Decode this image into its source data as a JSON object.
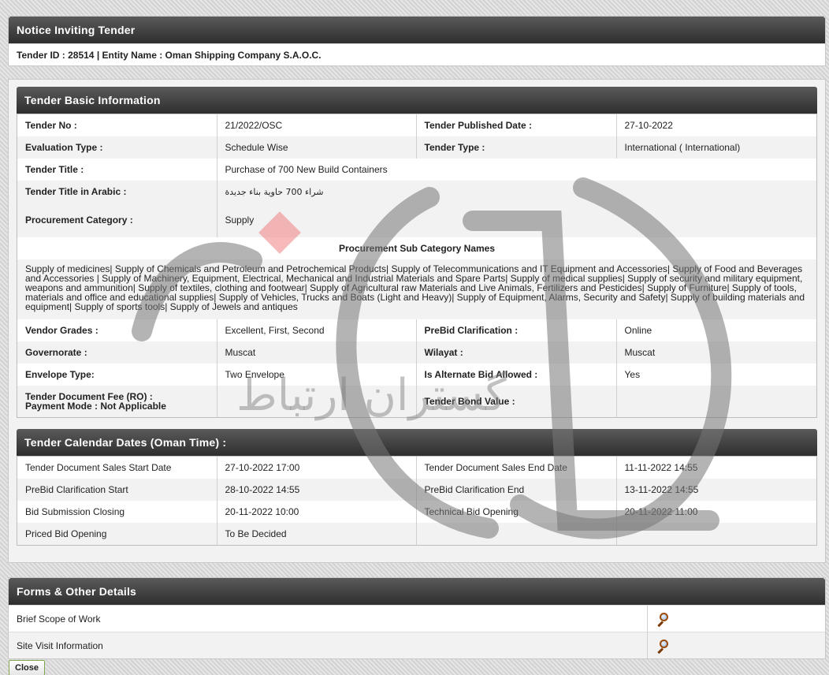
{
  "nit": {
    "title": "Notice Inviting Tender",
    "subline": "Tender ID : 28514 | Entity Name : Oman Shipping Company S.A.O.C."
  },
  "basic": {
    "title": "Tender Basic Information",
    "rows": [
      {
        "l1": "Tender No :",
        "v1": "21/2022/OSC",
        "l2": "Tender Published Date :",
        "v2": "27-10-2022"
      },
      {
        "l1": "Evaluation Type :",
        "v1": "Schedule Wise",
        "l2": "Tender Type :",
        "v2": "International  ( International)"
      }
    ],
    "tender_title_label": "Tender Title :",
    "tender_title": "Purchase of 700 New Build Containers",
    "arabic_label": "Tender Title in Arabic :",
    "arabic_title": "شراء 700 حاوية بناء جديدة",
    "proc_cat_label": "Procurement Category :",
    "proc_cat": "Supply",
    "subcat_title": "Procurement Sub Category Names",
    "subcat_text": "Supply of medicines| Supply of Chemicals and Petroleum and Petrochemical Products| Supply of Telecommunications and IT Equipment and Accessories| Supply of Food and Beverages and Accessories | Supply of Machinery, Equipment, Electrical, Mechanical and Industrial Materials and Spare Parts| Supply of medical supplies| Supply of security and military equipment, weapons and ammunition| Supply of textiles, clothing and footwear| Supply of Agricultural raw Materials and Live Animals, Fertilizers and Pesticides| Supply of Furniture| Supply of tools, materials and office and educational supplies| Supply of Vehicles, Trucks and Boats (Light and Heavy)| Supply of Equipment, Alarms, Security and Safety| Supply of building materials and equipment| Supply of sports tools| Supply of Jewels and antiques",
    "rows2": [
      {
        "l1": "Vendor Grades :",
        "v1": "Excellent, First, Second",
        "l2": "PreBid Clarification :",
        "v2": "Online"
      },
      {
        "l1": "Governorate :",
        "v1": "Muscat",
        "l2": "Wilayat :",
        "v2": "Muscat"
      },
      {
        "l1": "Envelope Type:",
        "v1": "Two Envelope",
        "l2": "Is Alternate Bid Allowed :",
        "v2": "Yes"
      }
    ],
    "fee_label": "Tender Document Fee (RO) :",
    "payment_mode": "Payment Mode :  Not Applicable",
    "bond_label": "Tender Bond Value :"
  },
  "calendar": {
    "title": "Tender Calendar Dates (Oman Time) :",
    "rows": [
      {
        "l1": "Tender Document Sales Start Date",
        "v1": "27-10-2022 17:00",
        "l2": "Tender Document Sales End Date",
        "v2": "11-11-2022 14:55"
      },
      {
        "l1": "PreBid Clarification Start",
        "v1": "28-10-2022 14:55",
        "l2": "PreBid Clarification End",
        "v2": "13-11-2022 14:55"
      },
      {
        "l1": "Bid Submission Closing",
        "v1": "20-11-2022 10:00",
        "l2": "Technical Bid Opening",
        "v2": "20-11-2022 11:00"
      },
      {
        "l1": "Priced Bid Opening",
        "v1": "To Be Decided",
        "l2": "",
        "v2": ""
      }
    ]
  },
  "forms": {
    "title": "Forms & Other Details",
    "items": [
      "Brief Scope of Work",
      "Site Visit Information"
    ],
    "view_icon": "magnifier-icon"
  },
  "close_label": "Close",
  "watermark_text": "گستران ارتباط"
}
